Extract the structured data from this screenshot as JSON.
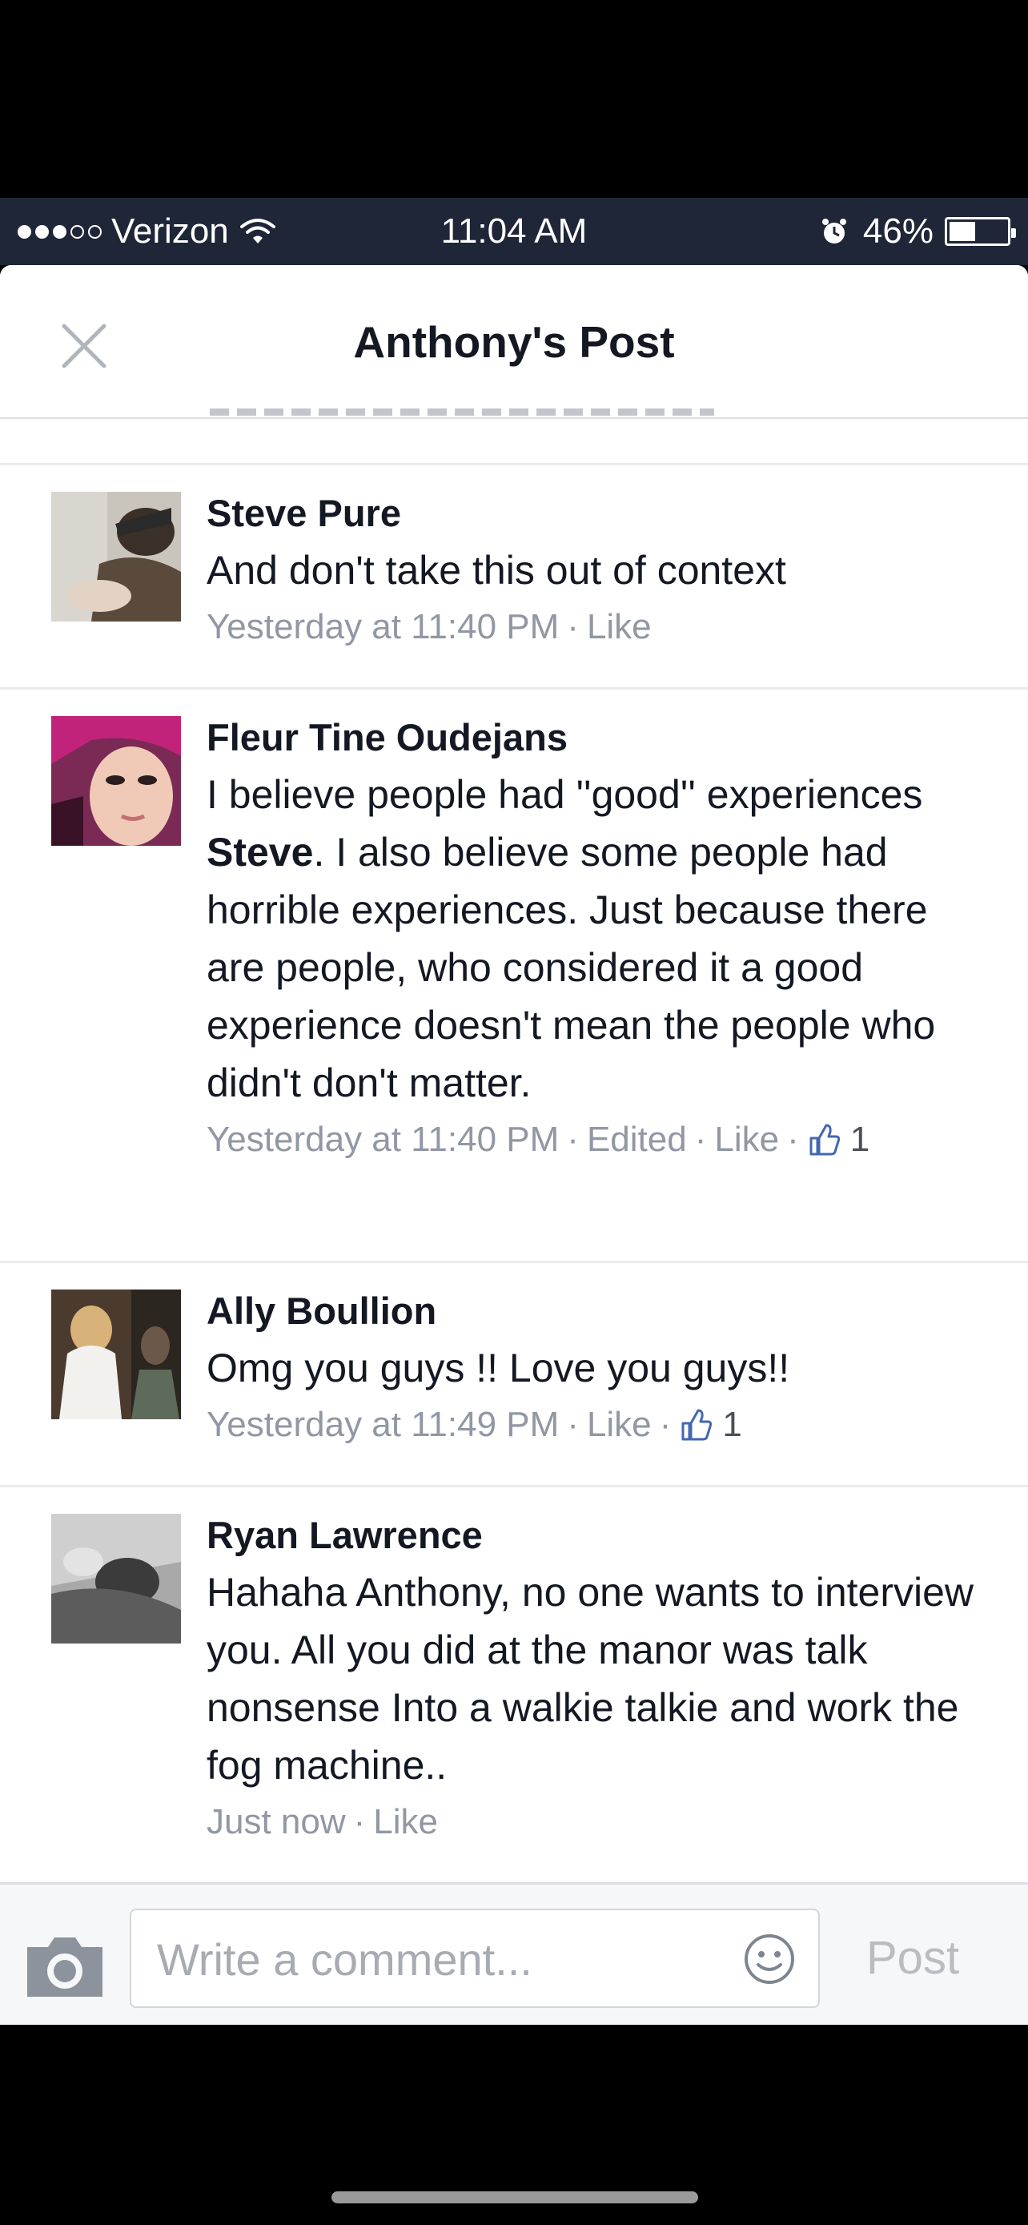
{
  "status_bar": {
    "carrier": "Verizon",
    "signal_bars_filled": 3,
    "signal_bars_total": 5,
    "time": "11:04 AM",
    "battery_percent": "46%",
    "battery_level": 0.46
  },
  "header": {
    "title": "Anthony's Post"
  },
  "comments": [
    {
      "author": "Steve Pure",
      "text": "And don't take this out of context",
      "timestamp": "Yesterday at 11:40 PM",
      "like_label": "Like"
    },
    {
      "author": "Fleur Tine Oudejans",
      "text_before": "I believe people had ''good'' experiences ",
      "text_mention": "Steve",
      "text_after": ". I also believe some people had horrible experiences. Just because there are people, who considered it a good experience doesn't mean the people who didn't don't matter.",
      "timestamp": "Yesterday at 11:40 PM",
      "edited_label": "Edited",
      "like_label": "Like",
      "like_count": "1"
    },
    {
      "author": "Ally Boullion",
      "text": "Omg you guys !! Love you guys!!",
      "timestamp": "Yesterday at 11:49 PM",
      "like_label": "Like",
      "like_count": "1"
    },
    {
      "author": "Ryan Lawrence",
      "text": "Hahaha Anthony, no one wants to interview you. All you did at the manor was talk nonsense Into a walkie talkie and work the fog machine..",
      "timestamp": "Just now",
      "like_label": "Like"
    }
  ],
  "composer": {
    "placeholder": "Write a comment...",
    "post_label": "Post"
  },
  "colors": {
    "status_bar_bg": "#1f2638",
    "name_text": "#141823",
    "meta_text": "#9197a3",
    "separator": "#e9ebee"
  },
  "icons": {
    "close": "close-icon",
    "wifi": "wifi-icon",
    "alarm": "alarm-icon",
    "battery": "battery-icon",
    "thumbs_up": "thumbs-up-icon",
    "camera": "camera-icon",
    "smiley": "smiley-icon"
  }
}
